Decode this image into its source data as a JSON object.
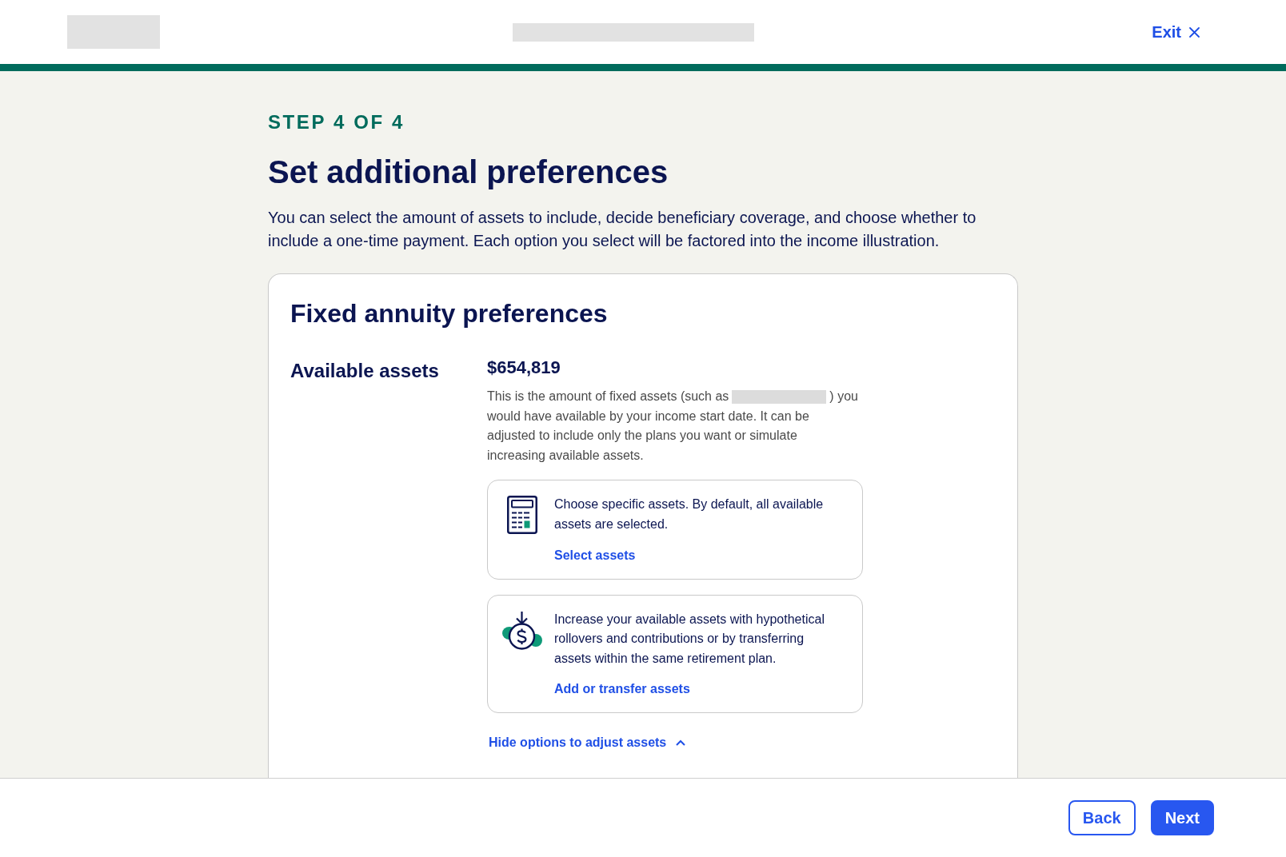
{
  "header": {
    "exit_label": "Exit"
  },
  "step_label": "STEP 4 OF 4",
  "title": "Set additional preferences",
  "intro": "You can select the amount of assets to include, decide beneficiary coverage, and choose whether to include a one-time payment. Each option you select will be factored into the income illustration.",
  "card": {
    "title": "Fixed annuity preferences",
    "section_label": "Available assets",
    "amount": "$654,819",
    "description": {
      "before_redaction": "This is the amount of fixed assets (such as",
      "after_redaction": ") you",
      "continued": "would have available by your income start date. It can be adjusted to include only the plans you want or simulate increasing available assets."
    },
    "options": [
      {
        "kind": "calculator",
        "text": "Choose specific assets. By default, all available assets are selected.",
        "link": "Select assets"
      },
      {
        "kind": "coin",
        "text": "Increase your available assets with hypothetical rollovers and contributions or by transferring assets within the same retirement plan.",
        "link": "Add or transfer assets"
      }
    ],
    "toggle": {
      "label": "Hide options to adjust assets",
      "expanded": true
    }
  },
  "footer": {
    "buttons": [
      {
        "label": "Back",
        "kind": "secondary"
      },
      {
        "label": "Next",
        "kind": "primary"
      }
    ]
  }
}
